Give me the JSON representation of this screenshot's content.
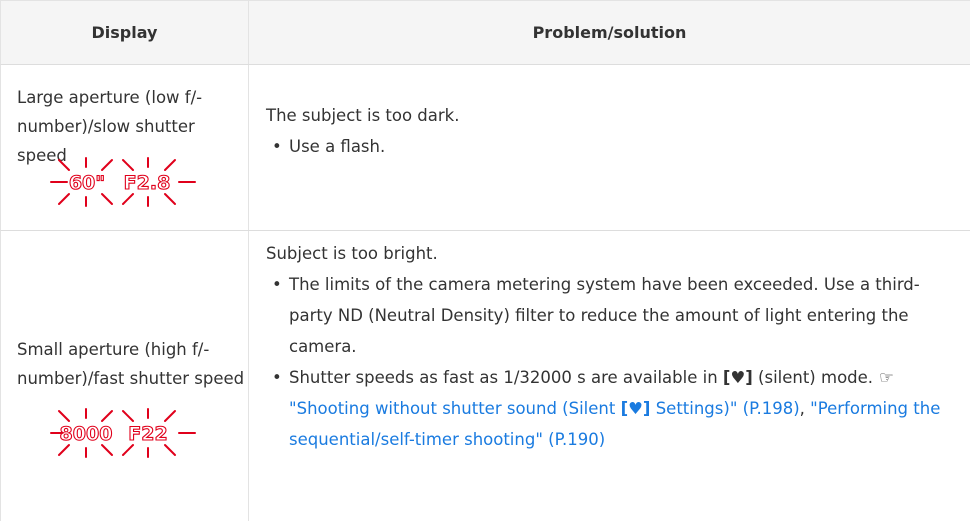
{
  "table": {
    "headers": {
      "display": "Display",
      "solution": "Problem/solution"
    },
    "rows": [
      {
        "display_label": "Large aperture (low f/-number)/slow shutter speed",
        "shutter_value": "60\"",
        "aperture_value": "F2.8",
        "problem": "The subject is too dark.",
        "bullets": [
          "Use a flash."
        ]
      },
      {
        "display_label": "Small aperture (high f/-number)/fast shutter speed",
        "shutter_value": "8000",
        "aperture_value": "F22",
        "problem": "Subject is too bright.",
        "bullet1": "The limits of the camera metering system have been exceeded. Use a third-party ND (Neutral Density) filter to reduce the amount of light entering the camera.",
        "bullet2_prefix": "Shutter speeds as fast as 1/32000 s are available in",
        "bullet2_heart": "[♥]",
        "bullet2_suffix": "(silent) mode.",
        "ref_icon": "☞",
        "link1_a": "\"Shooting without shutter sound (Silent",
        "link1_heart": "[♥]",
        "link1_b": "Settings)\" (P.198)",
        "separator": ",",
        "link2": "\"Performing the sequential/self-timer shooting\" (P.190)"
      }
    ]
  },
  "colors": {
    "border": "#e3e3e3",
    "header_bg": "#f5f5f5",
    "text": "#333333",
    "link": "#1a7be0",
    "blink": "#e0001b"
  }
}
